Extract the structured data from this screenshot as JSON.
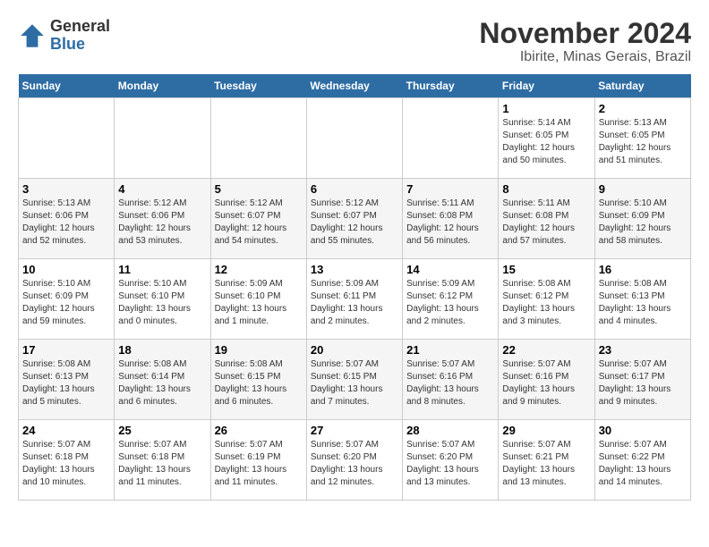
{
  "header": {
    "logo_general": "General",
    "logo_blue": "Blue",
    "month_title": "November 2024",
    "location": "Ibirite, Minas Gerais, Brazil"
  },
  "days_of_week": [
    "Sunday",
    "Monday",
    "Tuesday",
    "Wednesday",
    "Thursday",
    "Friday",
    "Saturday"
  ],
  "weeks": [
    [
      {
        "day": "",
        "info": ""
      },
      {
        "day": "",
        "info": ""
      },
      {
        "day": "",
        "info": ""
      },
      {
        "day": "",
        "info": ""
      },
      {
        "day": "",
        "info": ""
      },
      {
        "day": "1",
        "info": "Sunrise: 5:14 AM\nSunset: 6:05 PM\nDaylight: 12 hours and 50 minutes."
      },
      {
        "day": "2",
        "info": "Sunrise: 5:13 AM\nSunset: 6:05 PM\nDaylight: 12 hours and 51 minutes."
      }
    ],
    [
      {
        "day": "3",
        "info": "Sunrise: 5:13 AM\nSunset: 6:06 PM\nDaylight: 12 hours and 52 minutes."
      },
      {
        "day": "4",
        "info": "Sunrise: 5:12 AM\nSunset: 6:06 PM\nDaylight: 12 hours and 53 minutes."
      },
      {
        "day": "5",
        "info": "Sunrise: 5:12 AM\nSunset: 6:07 PM\nDaylight: 12 hours and 54 minutes."
      },
      {
        "day": "6",
        "info": "Sunrise: 5:12 AM\nSunset: 6:07 PM\nDaylight: 12 hours and 55 minutes."
      },
      {
        "day": "7",
        "info": "Sunrise: 5:11 AM\nSunset: 6:08 PM\nDaylight: 12 hours and 56 minutes."
      },
      {
        "day": "8",
        "info": "Sunrise: 5:11 AM\nSunset: 6:08 PM\nDaylight: 12 hours and 57 minutes."
      },
      {
        "day": "9",
        "info": "Sunrise: 5:10 AM\nSunset: 6:09 PM\nDaylight: 12 hours and 58 minutes."
      }
    ],
    [
      {
        "day": "10",
        "info": "Sunrise: 5:10 AM\nSunset: 6:09 PM\nDaylight: 12 hours and 59 minutes."
      },
      {
        "day": "11",
        "info": "Sunrise: 5:10 AM\nSunset: 6:10 PM\nDaylight: 13 hours and 0 minutes."
      },
      {
        "day": "12",
        "info": "Sunrise: 5:09 AM\nSunset: 6:10 PM\nDaylight: 13 hours and 1 minute."
      },
      {
        "day": "13",
        "info": "Sunrise: 5:09 AM\nSunset: 6:11 PM\nDaylight: 13 hours and 2 minutes."
      },
      {
        "day": "14",
        "info": "Sunrise: 5:09 AM\nSunset: 6:12 PM\nDaylight: 13 hours and 2 minutes."
      },
      {
        "day": "15",
        "info": "Sunrise: 5:08 AM\nSunset: 6:12 PM\nDaylight: 13 hours and 3 minutes."
      },
      {
        "day": "16",
        "info": "Sunrise: 5:08 AM\nSunset: 6:13 PM\nDaylight: 13 hours and 4 minutes."
      }
    ],
    [
      {
        "day": "17",
        "info": "Sunrise: 5:08 AM\nSunset: 6:13 PM\nDaylight: 13 hours and 5 minutes."
      },
      {
        "day": "18",
        "info": "Sunrise: 5:08 AM\nSunset: 6:14 PM\nDaylight: 13 hours and 6 minutes."
      },
      {
        "day": "19",
        "info": "Sunrise: 5:08 AM\nSunset: 6:15 PM\nDaylight: 13 hours and 6 minutes."
      },
      {
        "day": "20",
        "info": "Sunrise: 5:07 AM\nSunset: 6:15 PM\nDaylight: 13 hours and 7 minutes."
      },
      {
        "day": "21",
        "info": "Sunrise: 5:07 AM\nSunset: 6:16 PM\nDaylight: 13 hours and 8 minutes."
      },
      {
        "day": "22",
        "info": "Sunrise: 5:07 AM\nSunset: 6:16 PM\nDaylight: 13 hours and 9 minutes."
      },
      {
        "day": "23",
        "info": "Sunrise: 5:07 AM\nSunset: 6:17 PM\nDaylight: 13 hours and 9 minutes."
      }
    ],
    [
      {
        "day": "24",
        "info": "Sunrise: 5:07 AM\nSunset: 6:18 PM\nDaylight: 13 hours and 10 minutes."
      },
      {
        "day": "25",
        "info": "Sunrise: 5:07 AM\nSunset: 6:18 PM\nDaylight: 13 hours and 11 minutes."
      },
      {
        "day": "26",
        "info": "Sunrise: 5:07 AM\nSunset: 6:19 PM\nDaylight: 13 hours and 11 minutes."
      },
      {
        "day": "27",
        "info": "Sunrise: 5:07 AM\nSunset: 6:20 PM\nDaylight: 13 hours and 12 minutes."
      },
      {
        "day": "28",
        "info": "Sunrise: 5:07 AM\nSunset: 6:20 PM\nDaylight: 13 hours and 13 minutes."
      },
      {
        "day": "29",
        "info": "Sunrise: 5:07 AM\nSunset: 6:21 PM\nDaylight: 13 hours and 13 minutes."
      },
      {
        "day": "30",
        "info": "Sunrise: 5:07 AM\nSunset: 6:22 PM\nDaylight: 13 hours and 14 minutes."
      }
    ]
  ]
}
